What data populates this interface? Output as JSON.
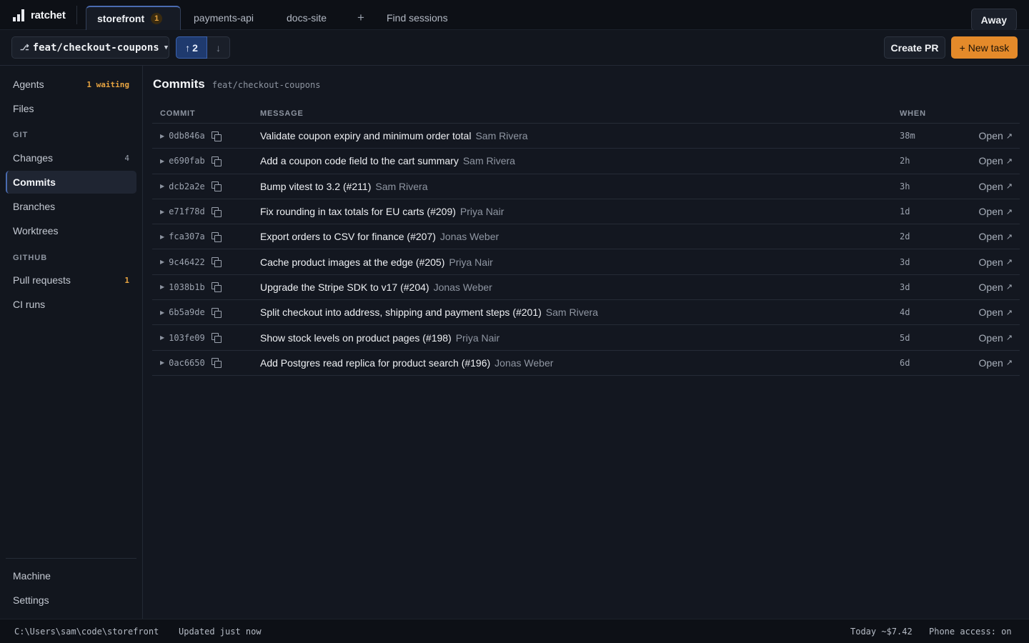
{
  "app": {
    "name": "ratchet"
  },
  "tabs": [
    {
      "label": "storefront",
      "badge": "1",
      "active": true
    },
    {
      "label": "payments-api",
      "active": false
    },
    {
      "label": "docs-site",
      "active": false
    }
  ],
  "tab_add_label": "+",
  "find_sessions_label": "Find sessions",
  "away_label": "Away",
  "branchbar": {
    "branch": "feat/checkout-coupons",
    "ahead": "2",
    "create_pr_label": "Create PR",
    "new_task_label": "+ New task"
  },
  "sidebar": {
    "agents": {
      "label": "Agents",
      "count": "1 waiting"
    },
    "files": {
      "label": "Files"
    },
    "git_section": "GIT",
    "changes": {
      "label": "Changes",
      "count": "4"
    },
    "commits": {
      "label": "Commits"
    },
    "branches": {
      "label": "Branches"
    },
    "worktrees": {
      "label": "Worktrees"
    },
    "github_section": "GITHUB",
    "pull_requests": {
      "label": "Pull requests",
      "count": "1"
    },
    "ci_runs": {
      "label": "CI runs"
    },
    "machine": {
      "label": "Machine"
    },
    "settings": {
      "label": "Settings"
    }
  },
  "main": {
    "title": "Commits",
    "branch": "feat/checkout-coupons",
    "columns": {
      "commit": "COMMIT",
      "message": "MESSAGE",
      "when": "WHEN"
    },
    "open_label": "Open",
    "commits": [
      {
        "sha": "0db846a",
        "message": "Validate coupon expiry and minimum order total",
        "author": "Sam Rivera",
        "when": "38m"
      },
      {
        "sha": "e690fab",
        "message": "Add a coupon code field to the cart summary",
        "author": "Sam Rivera",
        "when": "2h"
      },
      {
        "sha": "dcb2a2e",
        "message": "Bump vitest to 3.2 (#211)",
        "author": "Sam Rivera",
        "when": "3h"
      },
      {
        "sha": "e71f78d",
        "message": "Fix rounding in tax totals for EU carts (#209)",
        "author": "Priya Nair",
        "when": "1d"
      },
      {
        "sha": "fca307a",
        "message": "Export orders to CSV for finance (#207)",
        "author": "Jonas Weber",
        "when": "2d"
      },
      {
        "sha": "9c46422",
        "message": "Cache product images at the edge (#205)",
        "author": "Priya Nair",
        "when": "3d"
      },
      {
        "sha": "1038b1b",
        "message": "Upgrade the Stripe SDK to v17 (#204)",
        "author": "Jonas Weber",
        "when": "3d"
      },
      {
        "sha": "6b5a9de",
        "message": "Split checkout into address, shipping and payment steps (#201)",
        "author": "Sam Rivera",
        "when": "4d"
      },
      {
        "sha": "103fe09",
        "message": "Show stock levels on product pages (#198)",
        "author": "Priya Nair",
        "when": "5d"
      },
      {
        "sha": "0ac6650",
        "message": "Add Postgres read replica for product search (#196)",
        "author": "Jonas Weber",
        "when": "6d"
      }
    ]
  },
  "statusbar": {
    "path": "C:\\Users\\sam\\code\\storefront",
    "updated": "Updated just now",
    "cost": "Today ~$7.42",
    "phone": "Phone access: on"
  }
}
